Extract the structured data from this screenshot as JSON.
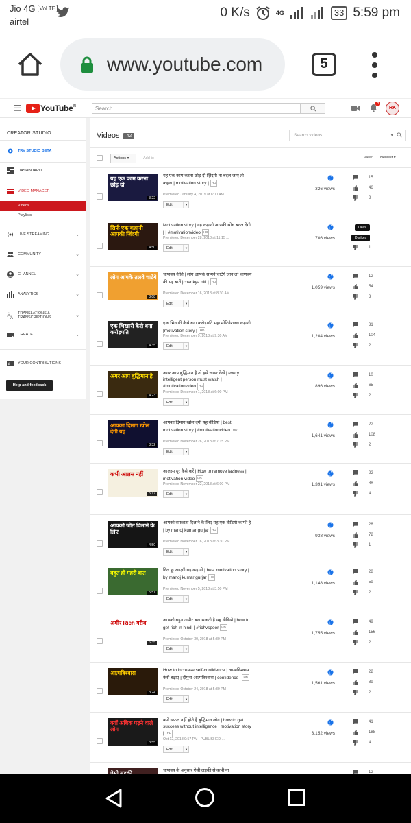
{
  "status_bar": {
    "carrier1": "Jio 4G",
    "volte": "VoLTE",
    "carrier2": "airtel",
    "speed": "0 K/s",
    "network": "4G",
    "battery": "33",
    "time": "5:59 pm"
  },
  "browser": {
    "url": "www.youtube.com",
    "tab_count": "5"
  },
  "yt": {
    "logo": "YouTube",
    "logo_region": "IN",
    "search_placeholder": "Search",
    "notif_count": "5",
    "avatar_initials": "RK"
  },
  "sidebar": {
    "heading": "CREATOR STUDIO",
    "channel_name": "TRV STUDIO BETA",
    "dashboard": "DASHBOARD",
    "video_manager": "VIDEO MANAGER",
    "videos": "Videos",
    "playlists": "Playlists",
    "live_streaming": "LIVE STREAMING",
    "community": "COMMUNITY",
    "channel": "CHANNEL",
    "analytics": "ANALYTICS",
    "translations": "TRANSLATIONS & TRANSCRIPTIONS",
    "create": "CREATE",
    "your_contributions": "YOUR CONTRIBUTIONS",
    "help_feedback": "Help and feedback"
  },
  "main": {
    "title": "Videos",
    "count": "42",
    "search_placeholder": "Search videos",
    "actions": "Actions",
    "add_to": "Add to",
    "view_label": "View:",
    "sort": "Newest",
    "edit_label": "Edit",
    "hd": "HD",
    "tooltip_likes": "Likes",
    "tooltip_dislikes": "Dislikes"
  },
  "videos": [
    {
      "title": "यह एक काम करना छोड़ दो ज़िंदगी ना बदल जाए तो कहना | motivation story |",
      "hd": true,
      "date": "Premiered January 4, 2019 at 8:00 AM",
      "views": "326 views",
      "comments": "15",
      "likes": "46",
      "dislikes": "2",
      "duration": "3:22",
      "thumb_text": "यह एक काम करना छोड़ दो",
      "thumb_bg": "#1a1a40",
      "thumb_fg": "#ffffff"
    },
    {
      "title": "Motivation story | यह कहानी आपकी सोच बदल देगी | | #motivationvideo",
      "hd": true,
      "date": "Premiered December 28, 2018 at 11:15 ...",
      "views": "706 views",
      "comments": "",
      "likes": "",
      "dislikes": "1",
      "duration": "4:50",
      "thumb_text": "सिर्फ एक कहानी आपकी ज़िंदगी",
      "thumb_bg": "#2b1810",
      "thumb_fg": "#ffcc00"
    },
    {
      "title": "चाणक्य नीति | लोग आपके सामने चाटेंगे जान लो चाणक्य की यह बातें |chankya niti |",
      "hd": true,
      "date": "Premiered December 16, 2018 at 8:30 AM",
      "views": "1,059 views",
      "comments": "12",
      "likes": "54",
      "dislikes": "3",
      "duration": "3:08",
      "thumb_text": "लोग आपके तलवे चाटेंगे",
      "thumb_bg": "#f0a030",
      "thumb_fg": "#ffffff"
    },
    {
      "title": "एक भिखारी कैसे बना करोड़पति महा मोटिवेशनल कहानी |motivation story |",
      "hd": true,
      "date": "Premiered December 9, 2018 at 9:30 AM",
      "views": "1,204 views",
      "comments": "31",
      "likes": "104",
      "dislikes": "2",
      "duration": "4:35",
      "thumb_text": "एक भिखारी कैसे बना करोड़पति",
      "thumb_bg": "#222222",
      "thumb_fg": "#ffffff"
    },
    {
      "title": "अगर आप बुद्धिमान है तो इसे जरूर देखें | every intelligent person must watch | #motivationvideo",
      "hd": true,
      "date": "Premiered December 1, 2018 at 6:00 PM",
      "views": "896 views",
      "comments": "10",
      "likes": "65",
      "dislikes": "2",
      "duration": "4:23",
      "thumb_text": "अगर आप बुद्धिमान है",
      "thumb_bg": "#3a2a10",
      "thumb_fg": "#ffdd00"
    },
    {
      "title": "आपका दिमाग खोल देगी यह वीडियो | best motivation story | #motivationvideo",
      "hd": true,
      "date": "Premiered November 26, 2018 at 7:15 PM",
      "views": "1,641 views",
      "comments": "22",
      "likes": "108",
      "dislikes": "2",
      "duration": "3:32",
      "thumb_text": "आपका दिमाग खोल देगी यह",
      "thumb_bg": "#101030",
      "thumb_fg": "#ff9900"
    },
    {
      "title": "आलस्य दूर कैसे करें | How to remove laziness | motivation video",
      "hd": true,
      "date": "Premiered November 22, 2018 at 6:00 PM",
      "views": "1,391 views",
      "comments": "22",
      "likes": "88",
      "dislikes": "4",
      "duration": "5:17",
      "thumb_text": "कभी आलस नहीं",
      "thumb_bg": "#f5f0e0",
      "thumb_fg": "#cc0000"
    },
    {
      "title": "आपको सफलता दिलाने के लिए यह एक वीडियो काफी है | by manoj kumar gurjar",
      "hd": true,
      "date": "Premiered November 16, 2018 at 3:30 PM",
      "views": "938 views",
      "comments": "28",
      "likes": "72",
      "dislikes": "1",
      "duration": "4:50",
      "thumb_text": "आपको जीत दिलाने के लिए",
      "thumb_bg": "#151515",
      "thumb_fg": "#ffffff"
    },
    {
      "title": "दिल छू जाएगी यह कहानी | best motivation story | by manoj kumar gurjar",
      "hd": true,
      "date": "Premiered November 5, 2018 at 3:50 PM",
      "views": "1,148 views",
      "comments": "28",
      "likes": "59",
      "dislikes": "2",
      "duration": "5:51",
      "thumb_text": "बहुत ही गहरी बात",
      "thumb_bg": "#3a6a30",
      "thumb_fg": "#ffff00"
    },
    {
      "title": "आपको बहुत अमीर बना सकती है यह वीडियो | how to get rich in hindi | #richvspoor",
      "hd": true,
      "date": "Premiered October 30, 2018 at 5:30 PM",
      "views": "1,755 views",
      "comments": "49",
      "likes": "156",
      "dislikes": "2",
      "duration": "6:35",
      "thumb_text": "अमीर Rich गरीब",
      "thumb_bg": "#ffffff",
      "thumb_fg": "#cc0000"
    },
    {
      "title": "How to increase self-confidence | आत्मविश्वास कैसे बढ़ाए | दोगुना आत्मविश्वास | confidence |",
      "hd": true,
      "date": "Premiered October 24, 2018 at 5:30 PM",
      "views": "1,561 views",
      "comments": "22",
      "likes": "89",
      "dislikes": "2",
      "duration": "3:24",
      "thumb_text": "आत्मविश्वास",
      "thumb_bg": "#2a1a0a",
      "thumb_fg": "#ffcc00"
    },
    {
      "title": "क्यों सफल नहीं होते है बुद्धिमान लोग | how to get success without intelligence | motivation story |",
      "hd": true,
      "date": "Oct 12, 2018 9:57 PM | PUBLISHED ...",
      "views": "3,152 views",
      "comments": "41",
      "likes": "188",
      "dislikes": "4",
      "duration": "3:55",
      "thumb_text": "क्यों अधिक पढ़ने वाले लोग",
      "thumb_bg": "#1a1a1a",
      "thumb_fg": "#ff3333"
    },
    {
      "title": "चाणक्य के अनुसार ऐसी लड़की से कभी ना",
      "hd": false,
      "date": "",
      "views": "",
      "comments": "12",
      "likes": "",
      "dislikes": "",
      "duration": "",
      "thumb_text": "ऐसी लड़की",
      "thumb_bg": "#402020",
      "thumb_fg": "#ffffff"
    }
  ]
}
